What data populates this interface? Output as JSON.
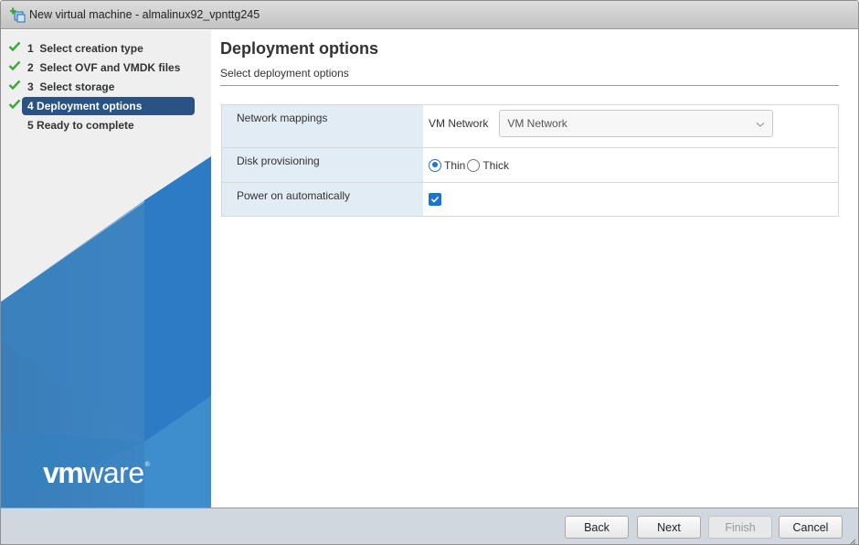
{
  "window": {
    "title": "New virtual machine - almalinux92_vpnttg245",
    "icon": "new-vm-icon"
  },
  "sidebar": {
    "steps": [
      {
        "number": "1",
        "label": "Select creation type",
        "completed": true,
        "active": false
      },
      {
        "number": "2",
        "label": "Select OVF and VMDK files",
        "completed": true,
        "active": false
      },
      {
        "number": "3",
        "label": "Select storage",
        "completed": true,
        "active": false
      },
      {
        "number": "4",
        "label": "Deployment options",
        "completed": true,
        "active": true
      },
      {
        "number": "5",
        "label": "Ready to complete",
        "completed": false,
        "active": false
      }
    ],
    "logo": {
      "vm": "vm",
      "ware": "ware",
      "reg": "®"
    }
  },
  "main": {
    "title": "Deployment options",
    "subtitle": "Select deployment options",
    "options": {
      "network_mappings": {
        "label": "Network mappings",
        "source_network": "VM Network",
        "selected_network": "VM Network"
      },
      "disk_provisioning": {
        "label": "Disk provisioning",
        "choices": [
          "Thin",
          "Thick"
        ],
        "selected": "Thin"
      },
      "power_on": {
        "label": "Power on automatically",
        "checked": true
      }
    }
  },
  "footer": {
    "back": "Back",
    "next": "Next",
    "finish": "Finish",
    "cancel": "Cancel"
  },
  "colors": {
    "accent": "#1a73d6",
    "active_step": "#2a5282",
    "check_green": "#3aaa35",
    "label_cell_bg": "#e2ecf4"
  }
}
